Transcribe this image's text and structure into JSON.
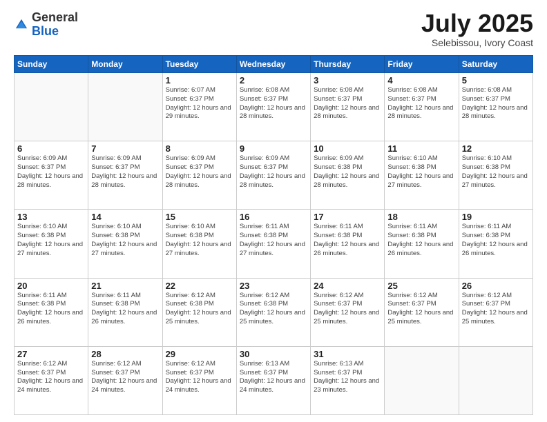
{
  "header": {
    "logo_general": "General",
    "logo_blue": "Blue",
    "month_title": "July 2025",
    "location": "Selebissou, Ivory Coast"
  },
  "days_of_week": [
    "Sunday",
    "Monday",
    "Tuesday",
    "Wednesday",
    "Thursday",
    "Friday",
    "Saturday"
  ],
  "weeks": [
    [
      {
        "day": "",
        "sunrise": "",
        "sunset": "",
        "daylight": ""
      },
      {
        "day": "",
        "sunrise": "",
        "sunset": "",
        "daylight": ""
      },
      {
        "day": "1",
        "sunrise": "Sunrise: 6:07 AM",
        "sunset": "Sunset: 6:37 PM",
        "daylight": "Daylight: 12 hours and 29 minutes."
      },
      {
        "day": "2",
        "sunrise": "Sunrise: 6:08 AM",
        "sunset": "Sunset: 6:37 PM",
        "daylight": "Daylight: 12 hours and 28 minutes."
      },
      {
        "day": "3",
        "sunrise": "Sunrise: 6:08 AM",
        "sunset": "Sunset: 6:37 PM",
        "daylight": "Daylight: 12 hours and 28 minutes."
      },
      {
        "day": "4",
        "sunrise": "Sunrise: 6:08 AM",
        "sunset": "Sunset: 6:37 PM",
        "daylight": "Daylight: 12 hours and 28 minutes."
      },
      {
        "day": "5",
        "sunrise": "Sunrise: 6:08 AM",
        "sunset": "Sunset: 6:37 PM",
        "daylight": "Daylight: 12 hours and 28 minutes."
      }
    ],
    [
      {
        "day": "6",
        "sunrise": "Sunrise: 6:09 AM",
        "sunset": "Sunset: 6:37 PM",
        "daylight": "Daylight: 12 hours and 28 minutes."
      },
      {
        "day": "7",
        "sunrise": "Sunrise: 6:09 AM",
        "sunset": "Sunset: 6:37 PM",
        "daylight": "Daylight: 12 hours and 28 minutes."
      },
      {
        "day": "8",
        "sunrise": "Sunrise: 6:09 AM",
        "sunset": "Sunset: 6:37 PM",
        "daylight": "Daylight: 12 hours and 28 minutes."
      },
      {
        "day": "9",
        "sunrise": "Sunrise: 6:09 AM",
        "sunset": "Sunset: 6:37 PM",
        "daylight": "Daylight: 12 hours and 28 minutes."
      },
      {
        "day": "10",
        "sunrise": "Sunrise: 6:09 AM",
        "sunset": "Sunset: 6:38 PM",
        "daylight": "Daylight: 12 hours and 28 minutes."
      },
      {
        "day": "11",
        "sunrise": "Sunrise: 6:10 AM",
        "sunset": "Sunset: 6:38 PM",
        "daylight": "Daylight: 12 hours and 27 minutes."
      },
      {
        "day": "12",
        "sunrise": "Sunrise: 6:10 AM",
        "sunset": "Sunset: 6:38 PM",
        "daylight": "Daylight: 12 hours and 27 minutes."
      }
    ],
    [
      {
        "day": "13",
        "sunrise": "Sunrise: 6:10 AM",
        "sunset": "Sunset: 6:38 PM",
        "daylight": "Daylight: 12 hours and 27 minutes."
      },
      {
        "day": "14",
        "sunrise": "Sunrise: 6:10 AM",
        "sunset": "Sunset: 6:38 PM",
        "daylight": "Daylight: 12 hours and 27 minutes."
      },
      {
        "day": "15",
        "sunrise": "Sunrise: 6:10 AM",
        "sunset": "Sunset: 6:38 PM",
        "daylight": "Daylight: 12 hours and 27 minutes."
      },
      {
        "day": "16",
        "sunrise": "Sunrise: 6:11 AM",
        "sunset": "Sunset: 6:38 PM",
        "daylight": "Daylight: 12 hours and 27 minutes."
      },
      {
        "day": "17",
        "sunrise": "Sunrise: 6:11 AM",
        "sunset": "Sunset: 6:38 PM",
        "daylight": "Daylight: 12 hours and 26 minutes."
      },
      {
        "day": "18",
        "sunrise": "Sunrise: 6:11 AM",
        "sunset": "Sunset: 6:38 PM",
        "daylight": "Daylight: 12 hours and 26 minutes."
      },
      {
        "day": "19",
        "sunrise": "Sunrise: 6:11 AM",
        "sunset": "Sunset: 6:38 PM",
        "daylight": "Daylight: 12 hours and 26 minutes."
      }
    ],
    [
      {
        "day": "20",
        "sunrise": "Sunrise: 6:11 AM",
        "sunset": "Sunset: 6:38 PM",
        "daylight": "Daylight: 12 hours and 26 minutes."
      },
      {
        "day": "21",
        "sunrise": "Sunrise: 6:11 AM",
        "sunset": "Sunset: 6:38 PM",
        "daylight": "Daylight: 12 hours and 26 minutes."
      },
      {
        "day": "22",
        "sunrise": "Sunrise: 6:12 AM",
        "sunset": "Sunset: 6:38 PM",
        "daylight": "Daylight: 12 hours and 25 minutes."
      },
      {
        "day": "23",
        "sunrise": "Sunrise: 6:12 AM",
        "sunset": "Sunset: 6:38 PM",
        "daylight": "Daylight: 12 hours and 25 minutes."
      },
      {
        "day": "24",
        "sunrise": "Sunrise: 6:12 AM",
        "sunset": "Sunset: 6:37 PM",
        "daylight": "Daylight: 12 hours and 25 minutes."
      },
      {
        "day": "25",
        "sunrise": "Sunrise: 6:12 AM",
        "sunset": "Sunset: 6:37 PM",
        "daylight": "Daylight: 12 hours and 25 minutes."
      },
      {
        "day": "26",
        "sunrise": "Sunrise: 6:12 AM",
        "sunset": "Sunset: 6:37 PM",
        "daylight": "Daylight: 12 hours and 25 minutes."
      }
    ],
    [
      {
        "day": "27",
        "sunrise": "Sunrise: 6:12 AM",
        "sunset": "Sunset: 6:37 PM",
        "daylight": "Daylight: 12 hours and 24 minutes."
      },
      {
        "day": "28",
        "sunrise": "Sunrise: 6:12 AM",
        "sunset": "Sunset: 6:37 PM",
        "daylight": "Daylight: 12 hours and 24 minutes."
      },
      {
        "day": "29",
        "sunrise": "Sunrise: 6:12 AM",
        "sunset": "Sunset: 6:37 PM",
        "daylight": "Daylight: 12 hours and 24 minutes."
      },
      {
        "day": "30",
        "sunrise": "Sunrise: 6:13 AM",
        "sunset": "Sunset: 6:37 PM",
        "daylight": "Daylight: 12 hours and 24 minutes."
      },
      {
        "day": "31",
        "sunrise": "Sunrise: 6:13 AM",
        "sunset": "Sunset: 6:37 PM",
        "daylight": "Daylight: 12 hours and 23 minutes."
      },
      {
        "day": "",
        "sunrise": "",
        "sunset": "",
        "daylight": ""
      },
      {
        "day": "",
        "sunrise": "",
        "sunset": "",
        "daylight": ""
      }
    ]
  ]
}
